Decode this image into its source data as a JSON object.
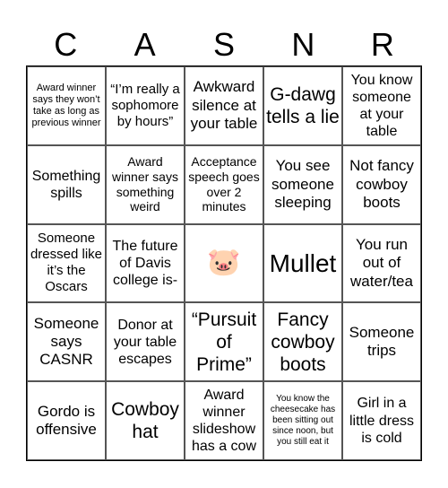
{
  "header": [
    "C",
    "A",
    "S",
    "N",
    "R"
  ],
  "cells": [
    "Award winner says they won’t take as long as previous winner",
    "“I’m really a sophomore by hours”",
    "Awkward silence at your table",
    "G-dawg tells a lie",
    "You know someone at your table",
    "Something spills",
    "Award winner says something weird",
    "Acceptance speech goes over 2 minutes",
    "You see someone sleeping",
    "Not fancy cowboy boots",
    "Someone dressed like it’s the Oscars",
    "The future of Davis college is-",
    "🐷",
    "Mullet",
    "You run out of water/tea",
    "Someone says CASNR",
    "Donor at your table escapes",
    "“Pursuit of Prime”",
    "Fancy cowboy boots",
    "Someone trips",
    "Gordo is offensive",
    "Cowboy hat",
    "Award winner slideshow has a cow",
    "You know the cheesecake has been sitting out since noon, but you still eat it",
    "Girl in a little dress is cold"
  ]
}
